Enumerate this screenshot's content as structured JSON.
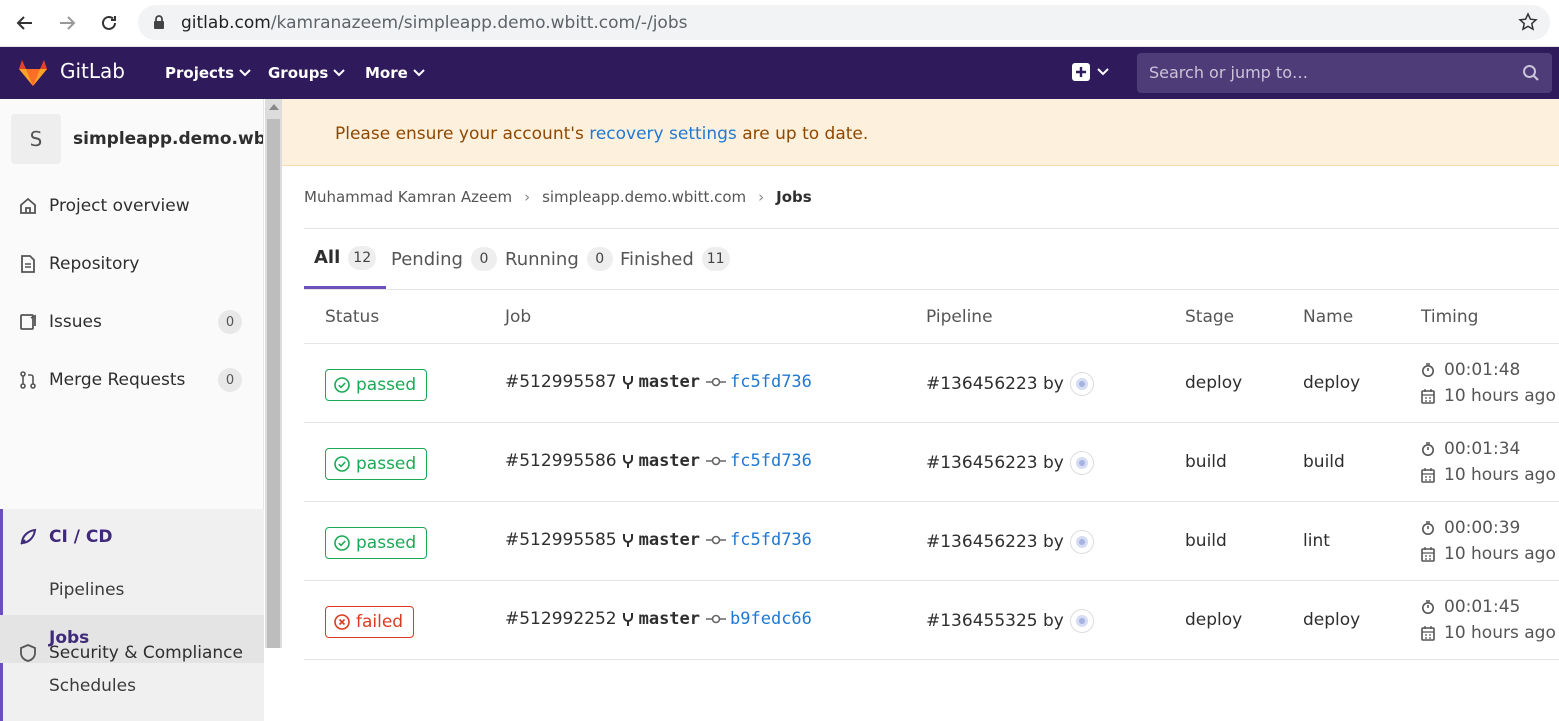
{
  "browser": {
    "url_domain": "gitlab.com",
    "url_path": "/kamranazeem/simpleapp.demo.wbitt.com/-/jobs"
  },
  "gitlab_nav": {
    "brand": "GitLab",
    "menus": [
      "Projects",
      "Groups",
      "More"
    ],
    "search_placeholder": "Search or jump to…"
  },
  "sidebar": {
    "project_initial": "S",
    "project_name": "simpleapp.demo.wbi...",
    "items": [
      {
        "label": "Project overview",
        "icon": "home-icon"
      },
      {
        "label": "Repository",
        "icon": "document-icon"
      },
      {
        "label": "Issues",
        "icon": "issues-icon",
        "count": "0"
      },
      {
        "label": "Merge Requests",
        "icon": "merge-request-icon",
        "count": "0"
      },
      {
        "label": "CI / CD",
        "icon": "rocket-icon"
      }
    ],
    "cicd_sub": [
      "Pipelines",
      "Jobs",
      "Schedules"
    ],
    "next_item_partial": "Security & Compliance"
  },
  "alert": {
    "text_before": "Please ensure your account's ",
    "link": "recovery settings",
    "text_after": " are up to date."
  },
  "breadcrumb": [
    "Muhammad Kamran Azeem",
    "simpleapp.demo.wbitt.com",
    "Jobs"
  ],
  "tabs": [
    {
      "label": "All",
      "count": "12"
    },
    {
      "label": "Pending",
      "count": "0"
    },
    {
      "label": "Running",
      "count": "0"
    },
    {
      "label": "Finished",
      "count": "11"
    }
  ],
  "table": {
    "headers": [
      "Status",
      "Job",
      "Pipeline",
      "Stage",
      "Name",
      "Timing"
    ],
    "rows": [
      {
        "status": "passed",
        "job": "#512995587",
        "branch": "master",
        "sha": "fc5fd736",
        "pipeline": "#136456223 by",
        "stage": "deploy",
        "name": "deploy",
        "duration": "00:01:48",
        "ago": "10 hours ago"
      },
      {
        "status": "passed",
        "job": "#512995586",
        "branch": "master",
        "sha": "fc5fd736",
        "pipeline": "#136456223 by",
        "stage": "build",
        "name": "build",
        "duration": "00:01:34",
        "ago": "10 hours ago"
      },
      {
        "status": "passed",
        "job": "#512995585",
        "branch": "master",
        "sha": "fc5fd736",
        "pipeline": "#136456223 by",
        "stage": "build",
        "name": "lint",
        "duration": "00:00:39",
        "ago": "10 hours ago"
      },
      {
        "status": "failed",
        "job": "#512992252",
        "branch": "master",
        "sha": "b9fedc66",
        "pipeline": "#136455325 by",
        "stage": "deploy",
        "name": "deploy",
        "duration": "00:01:45",
        "ago": "10 hours ago"
      }
    ]
  },
  "colors": {
    "nav_bg": "#2f1a5c",
    "passed": "#1aaa55",
    "failed": "#db3b21",
    "link": "#1f78d1",
    "active_accent": "#6b4fbb"
  }
}
